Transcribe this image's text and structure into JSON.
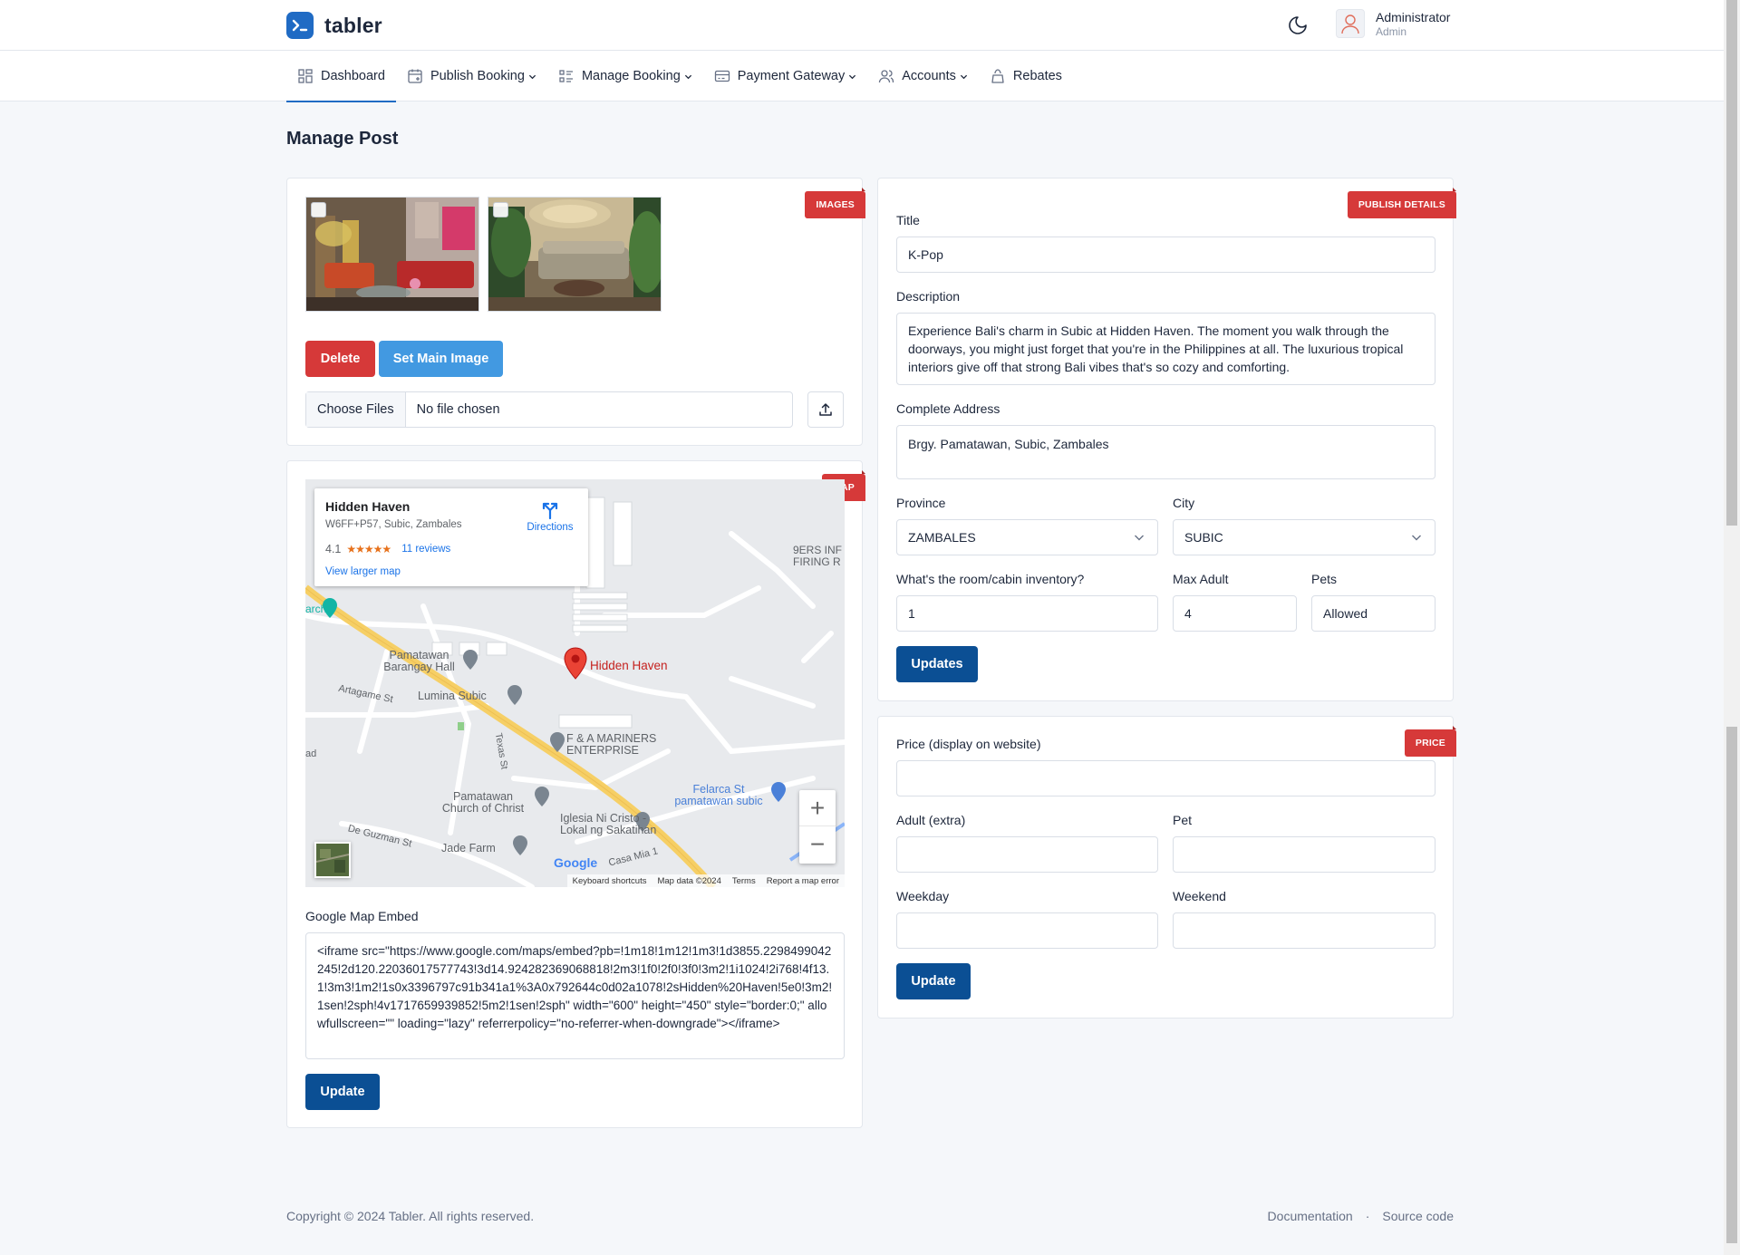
{
  "brand": {
    "name": "tabler"
  },
  "user": {
    "name": "Administrator",
    "role": "Admin"
  },
  "nav": {
    "dashboard": "Dashboard",
    "publish_booking": "Publish Booking",
    "manage_booking": "Manage Booking",
    "payment_gateway": "Payment Gateway",
    "accounts": "Accounts",
    "rebates": "Rebates"
  },
  "page": {
    "title": "Manage Post"
  },
  "images_card": {
    "ribbon": "IMAGES",
    "delete_label": "Delete",
    "set_main_label": "Set Main Image",
    "choose_files_label": "Choose Files",
    "no_file_label": "No file chosen"
  },
  "map_card": {
    "ribbon": "MAP",
    "place_name": "Hidden Haven",
    "plus_code": "W6FF+P57, Subic, Zambales",
    "rating": "4.1",
    "stars": "★★★★★",
    "reviews": "11 reviews",
    "directions": "Directions",
    "view_larger": "View larger map",
    "labels": {
      "barangay": "Pamatawan Barangay Hall",
      "lumina": "Lumina Subic",
      "artagame": "Artagame St",
      "mariners": "F & A MARINERS ENTERPRISE",
      "church": "Pamatawan Church of Christ",
      "iglesia": "Iglesia Ni Cristo - Lokal ng Sakatihan",
      "jade": "Jade Farm",
      "deguzman": "De Guzman St",
      "felarca": "Felarca St pamatawan subic",
      "casa": "Casa Mia 1",
      "firing": "9ERS INF FIRING R",
      "texas": "Texas St",
      "arch": "arch",
      "ad": "ad",
      "google": "Google"
    },
    "footer": {
      "shortcuts": "Keyboard shortcuts",
      "data": "Map data ©2024",
      "terms": "Terms",
      "report": "Report a map error"
    },
    "embed_label": "Google Map Embed",
    "embed_code": "<iframe src=\"https://www.google.com/maps/embed?pb=!1m18!1m12!1m3!1d3855.2298499042245!2d120.22036017577743!3d14.924282369068818!2m3!1f0!2f0!3f0!3m2!1i1024!2i768!4f13.1!3m3!1m2!1s0x3396797c91b341a1%3A0x792644c0d02a1078!2sHidden%20Haven!5e0!3m2!1sen!2sph!4v1717659939852!5m2!1sen!2sph\" width=\"600\" height=\"450\" style=\"border:0;\" allowfullscreen=\"\" loading=\"lazy\" referrerpolicy=\"no-referrer-when-downgrade\"></iframe>",
    "update_label": "Update"
  },
  "publish_card": {
    "ribbon": "PUBLISH DETAILS",
    "title_label": "Title",
    "title_value": "K-Pop",
    "description_label": "Description",
    "description_value": "Experience Bali's charm in Subic at Hidden Haven. The moment you walk through the doorways, you might just forget that you're in the Philippines at all. The luxurious tropical interiors give off that strong Bali vibes that's so cozy and comforting.",
    "address_label": "Complete Address",
    "address_value": "Brgy. Pamatawan, Subic, Zambales",
    "province_label": "Province",
    "province_value": "ZAMBALES",
    "city_label": "City",
    "city_value": "SUBIC",
    "inventory_label": "What's the room/cabin inventory?",
    "inventory_value": "1",
    "max_adult_label": "Max Adult",
    "max_adult_value": "4",
    "pets_label": "Pets",
    "pets_value": "Allowed",
    "update_label": "Updates"
  },
  "price_card": {
    "ribbon": "PRICE",
    "price_label": "Price (display on website)",
    "price_value": "",
    "adult_label": "Adult (extra)",
    "pet_label": "Pet",
    "weekday_label": "Weekday",
    "weekend_label": "Weekend",
    "update_label": "Update"
  },
  "footer": {
    "copyright": "Copyright © 2024 Tabler. All rights reserved.",
    "documentation": "Documentation",
    "separator": "·",
    "source_code": "Source code"
  },
  "colors": {
    "primary": "#206bc4",
    "danger": "#d63939",
    "info": "#4299e1",
    "navy": "#0b4f94"
  }
}
